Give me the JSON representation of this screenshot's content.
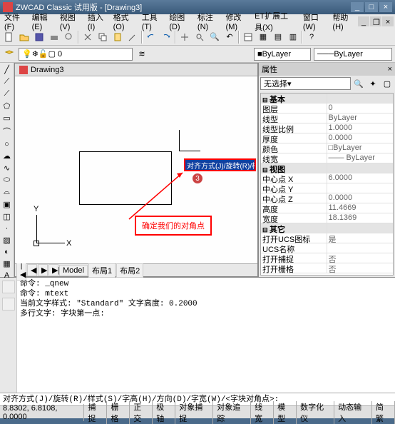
{
  "title": "ZWCAD Classic 试用版 - [Drawing3]",
  "menu": [
    "文件(F)",
    "编辑(E)",
    "视图(V)",
    "插入(I)",
    "格式(O)",
    "工具(T)",
    "绘图(D)",
    "标注(N)",
    "修改(M)",
    "ET扩展工具(X)",
    "窗口(W)",
    "帮助(H)"
  ],
  "tab_name": "Drawing3",
  "layer": {
    "bylayer1": "ByLayer",
    "bylayer2": "ByLayer"
  },
  "axis": {
    "y": "Y",
    "x": "X"
  },
  "annotation": "确定我们的对角点",
  "badge": "3",
  "cmd_highlight": "对齐方式(J)/旋转(R)/样式(S)/字高(H)/方向(D)/字宽(W)/<字块对角点>:",
  "model_tabs": {
    "nav": [
      "|◀",
      "◀",
      "▶",
      "▶|"
    ],
    "items": [
      "Model",
      "布局1",
      "布局2"
    ]
  },
  "properties": {
    "title": "属性",
    "selection": "无选择",
    "groups": [
      {
        "name": "基本",
        "rows": [
          {
            "k": "图层",
            "v": "0"
          },
          {
            "k": "线型",
            "v": "ByLayer"
          },
          {
            "k": "线型比例",
            "v": "1.0000"
          },
          {
            "k": "厚度",
            "v": "0.0000"
          },
          {
            "k": "颜色",
            "v": "□ByLayer"
          },
          {
            "k": "线宽",
            "v": "—— ByLayer"
          }
        ]
      },
      {
        "name": "视图",
        "rows": [
          {
            "k": "中心点 X",
            "v": "6.0000"
          },
          {
            "k": "中心点 Y",
            "v": ""
          },
          {
            "k": "中心点 Z",
            "v": "0.0000"
          },
          {
            "k": "高度",
            "v": "11.4669"
          },
          {
            "k": "宽度",
            "v": "18.1369"
          }
        ]
      },
      {
        "name": "其它",
        "rows": [
          {
            "k": "打开UCS图标",
            "v": "是"
          },
          {
            "k": "UCS名称",
            "v": ""
          },
          {
            "k": "打开捕捉",
            "v": "否"
          },
          {
            "k": "打开栅格",
            "v": "否"
          }
        ]
      }
    ]
  },
  "cmdwin": [
    "命令: _qnew",
    "命令: mtext",
    "当前文字样式: \"Standard\" 文字高度: 0.2000",
    "多行文字: 字块第一点:"
  ],
  "cmdline": "对齐方式(J)/旋转(R)/样式(S)/字高(H)/方向(D)/字宽(W)/<字块对角点>:",
  "status": {
    "coords": "8.8302, 6.8108, 0.0000",
    "btns": [
      "捕捉",
      "栅格",
      "正交",
      "极轴",
      "对象捕捉",
      "对象追踪",
      "线宽",
      "模型",
      "数字化仪",
      "动态输入",
      "简繁"
    ]
  }
}
